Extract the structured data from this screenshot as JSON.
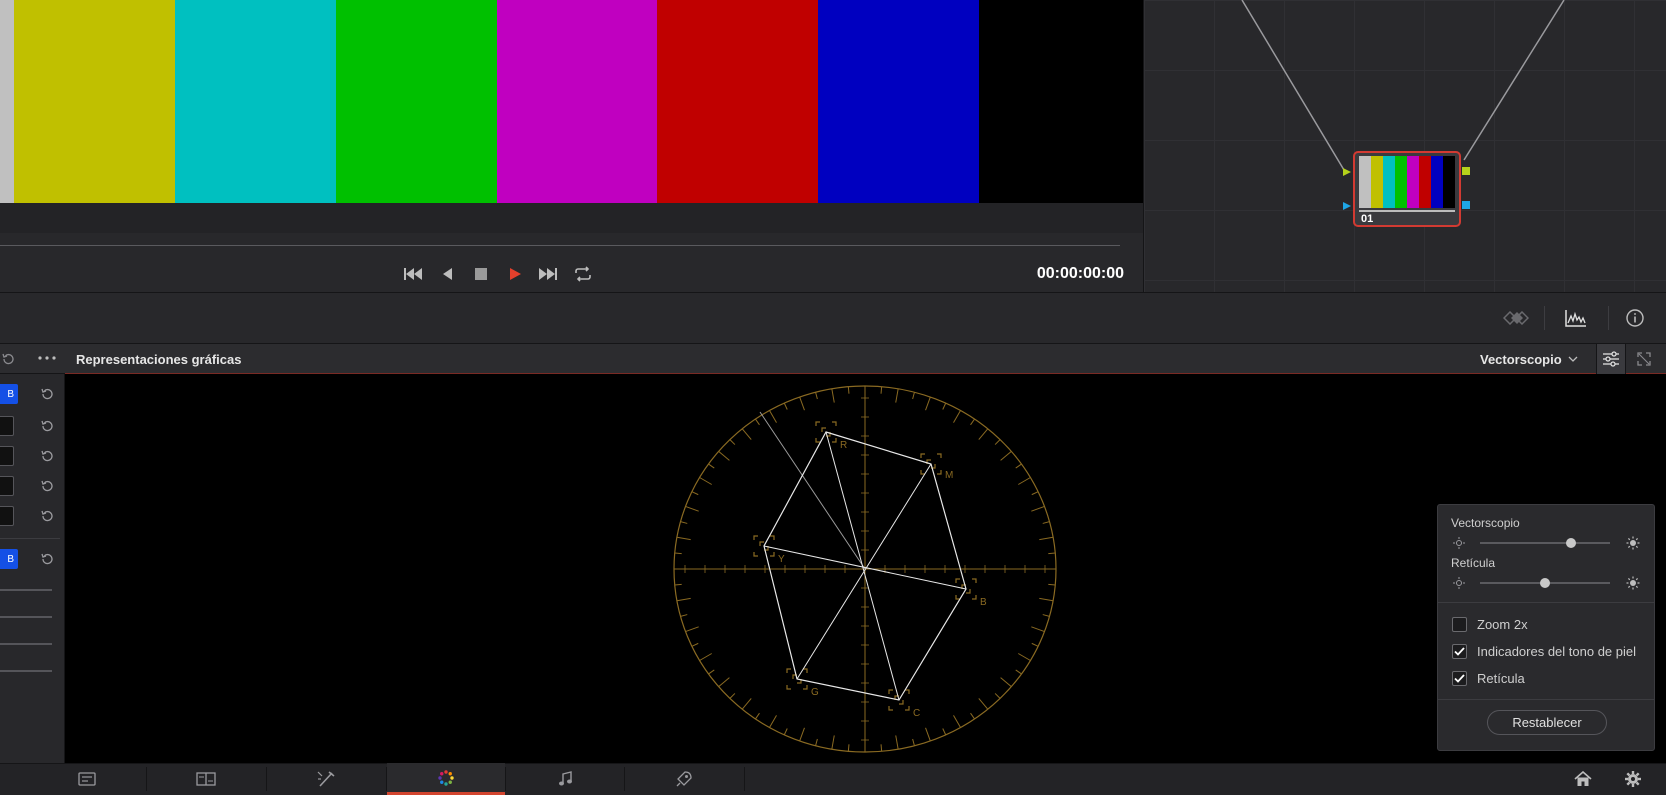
{
  "viewer": {
    "bar_colors": [
      "#c0c0c0",
      "#c0c000",
      "#00c0c0",
      "#00c000",
      "#c000c0",
      "#c00000",
      "#0000c0",
      "#000000"
    ],
    "timecode": "00:00:00:00",
    "transport": [
      "skip-to-start-icon",
      "step-back-icon",
      "stop-icon",
      "play-icon",
      "skip-to-end-icon",
      "loop-icon"
    ],
    "play_color": "#e5402c"
  },
  "node_editor": {
    "node_label": "01",
    "node_border_color": "#d23a32",
    "input_colors": [
      "#b5d21b",
      "#1ea6e6"
    ],
    "output_colors": [
      "#b5d21b",
      "#1ea6e6"
    ]
  },
  "toolbar": {
    "icons": [
      "keyframes-icon",
      "scopes-icon",
      "info-icon"
    ]
  },
  "left_panel": {
    "chips": [
      "B",
      "B"
    ]
  },
  "scopes": {
    "title": "Representaciones gráficas",
    "mode": "Vectorscopio",
    "targets": [
      "R",
      "M",
      "B",
      "C",
      "G",
      "Y"
    ],
    "graticule_color": "#8a6a22"
  },
  "scope_settings": {
    "vectorscope_label": "Vectorscopio",
    "vectorscope_brightness": 0.7,
    "graticule_label": "Retícula",
    "graticule_brightness": 0.5,
    "zoom_label": "Zoom 2x",
    "zoom_checked": false,
    "skin_tone_label": "Indicadores del tono de piel",
    "skin_tone_checked": true,
    "graticule_check_label": "Retícula",
    "graticule_checked": true,
    "reset_label": "Restablecer"
  },
  "pages": {
    "items": [
      "media-page-icon",
      "cut-page-icon",
      "edit-page-icon",
      "color-page-icon",
      "fairlight-page-icon",
      "deliver-page-icon"
    ],
    "active": "color-page-icon",
    "right_icons": [
      "home-icon",
      "settings-gear-icon"
    ]
  }
}
